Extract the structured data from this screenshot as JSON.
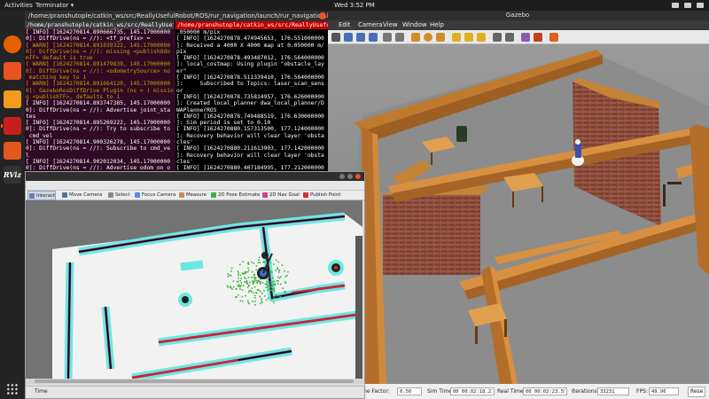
{
  "topbar": {
    "activities": "Activities",
    "app_menu": "Terminator",
    "clock": "Wed 3:52 PM"
  },
  "dock": {
    "items": [
      {
        "name": "firefox",
        "color": "#e66000"
      },
      {
        "name": "ubuntu-software",
        "color": "#e95420"
      },
      {
        "name": "sublime-text",
        "color": "#f29b1d"
      },
      {
        "name": "terminator",
        "color": "#c81e1e"
      },
      {
        "name": "rqt",
        "color": "#e2571e"
      },
      {
        "name": "rviz",
        "color": "#333333",
        "label": "RViz"
      }
    ]
  },
  "terminator": {
    "window_title": "/home/pranshutople/catkin_ws/src/ReallyUsefulRobot/ROS/rur_navigation/launch/rur_navigation.laun...",
    "left_pane": {
      "header": "/home/pranshutople/catkin_ws/src/ReallyUsefulRobot/R",
      "lines": [
        {
          "t": "[ INFO] [1624270814.890666735, 145.17000000",
          "warn": false
        },
        {
          "t": "0]: DiffDrive(ns = //): <tf_prefix> =",
          "warn": false
        },
        {
          "t": "[ WARN] [1624270814.891039322, 145.17000000",
          "warn": true
        },
        {
          "t": "0]: DiffDrive(ns = //): missing <publishOdo",
          "warn": true
        },
        {
          "t": "mTF> default is true",
          "warn": true
        },
        {
          "t": "[ WARN] [1624270814.891479839, 145.17000000",
          "warn": true
        },
        {
          "t": "0]: DiffDrive(ns = //): <odometrySource> no",
          "warn": true
        },
        {
          "t": " matching key to 1",
          "warn": true
        },
        {
          "t": "[ WARN] [1624270814.891664120, 145.17000000",
          "warn": true
        },
        {
          "t": "0]: GazeboRosDiffDrive Plugin (ns = ) missing",
          "warn": true
        },
        {
          "t": "g <publishTF>, defaults to 1",
          "warn": true
        },
        {
          "t": "[ INFO] [1624270814.893747385, 145.17000000",
          "warn": false
        },
        {
          "t": "0]: DiffDrive(ns = //): Advertise joint_sta",
          "warn": false
        },
        {
          "t": "tes",
          "warn": false
        },
        {
          "t": "[ INFO] [1624270814.895269222, 145.17000000",
          "warn": false
        },
        {
          "t": "0]: DiffDrive(ns = //): Try to subscribe to",
          "warn": false
        },
        {
          "t": " cmd_vel",
          "warn": false
        },
        {
          "t": "[ INFO] [1624270814.900326278, 145.17000000",
          "warn": false
        },
        {
          "t": "0]: DiffDrive(ns = //): Subscribe to cmd_ve",
          "warn": false
        },
        {
          "t": "l",
          "warn": false
        },
        {
          "t": "[ INFO] [1624270814.902012034, 145.17000000",
          "warn": false
        },
        {
          "t": "0]: DiffDrive(ns = //): Advertise odom on o",
          "warn": false
        },
        {
          "t": "dom",
          "warn": false
        }
      ]
    },
    "right_pane": {
      "header": "/home/pranshutople/catkin_ws/src/ReallyUsefulRobot/Ro",
      "lines": [
        ".050000 m/pix",
        "[ INFO] [1624270878.474945653, 176.551000000",
        "]: Received a 4000 X 4000 map at 0.050000 m/",
        "pix",
        "[ INFO] [1624270878.493487012, 176.564000000",
        "]: local_costmap: Using plugin \"obstacle_lay",
        "er\"",
        "[ INFO] [1624270878.511339410, 176.564000000",
        "]:     Subscribed to Topics: laser_scan_sens",
        "or",
        "[ INFO] [1624270878.735814957, 176.626000000",
        "]: Created local_planner dwa_local_planner/D",
        "WAPlannerROS",
        "[ INFO] [1624270878.749488519, 176.630000000",
        "]: Sim period is set to 0.10",
        "[ INFO] [1624270880.157313500, 177.124000000",
        "]: Recovery behavior will clear layer 'obsta",
        "cles'",
        "[ INFO] [1624270880.211613903, 177.142000000",
        "]: Recovery behavior will clear layer 'obsta",
        "cles'",
        "[ INFO] [1624270880.407184995, 177.212000000",
        "]: odom received!"
      ]
    }
  },
  "gazebo": {
    "title": "Gazebo",
    "menu": [
      "Edit",
      "Camera",
      "View",
      "Window",
      "Help"
    ],
    "status": {
      "real_time_factor_label": "Real Time Factor:",
      "real_time_factor": "0.50",
      "sim_time_label": "Sim Time:",
      "sim_time": "00 00:02:18.234",
      "real_time_label": "Real Time:",
      "real_time": "00 00:02:23.558",
      "iterations_label": "Iterations:",
      "iterations": "33231",
      "fps_label": "FPS:",
      "fps": "49.96",
      "reset_label": "Rese"
    }
  },
  "rviz": {
    "tools": [
      {
        "label": "Interact",
        "icon": "cursor-icon",
        "color": "#6a7fb0"
      },
      {
        "label": "Move Camera",
        "icon": "move-camera-icon",
        "color": "#5a6e9a"
      },
      {
        "label": "Select",
        "icon": "select-icon",
        "color": "#888888"
      },
      {
        "label": "Focus Camera",
        "icon": "focus-camera-icon",
        "color": "#5c8fd6"
      },
      {
        "label": "Measure",
        "icon": "measure-icon",
        "color": "#c09050"
      },
      {
        "label": "2D Pose Estimate",
        "icon": "pose-estimate-icon",
        "color": "#3fb03f"
      },
      {
        "label": "2D Nav Goal",
        "icon": "nav-goal-icon",
        "color": "#d04090"
      },
      {
        "label": "Publish Point",
        "icon": "publish-point-icon",
        "color": "#d03030"
      }
    ],
    "time_panel": "Time"
  }
}
